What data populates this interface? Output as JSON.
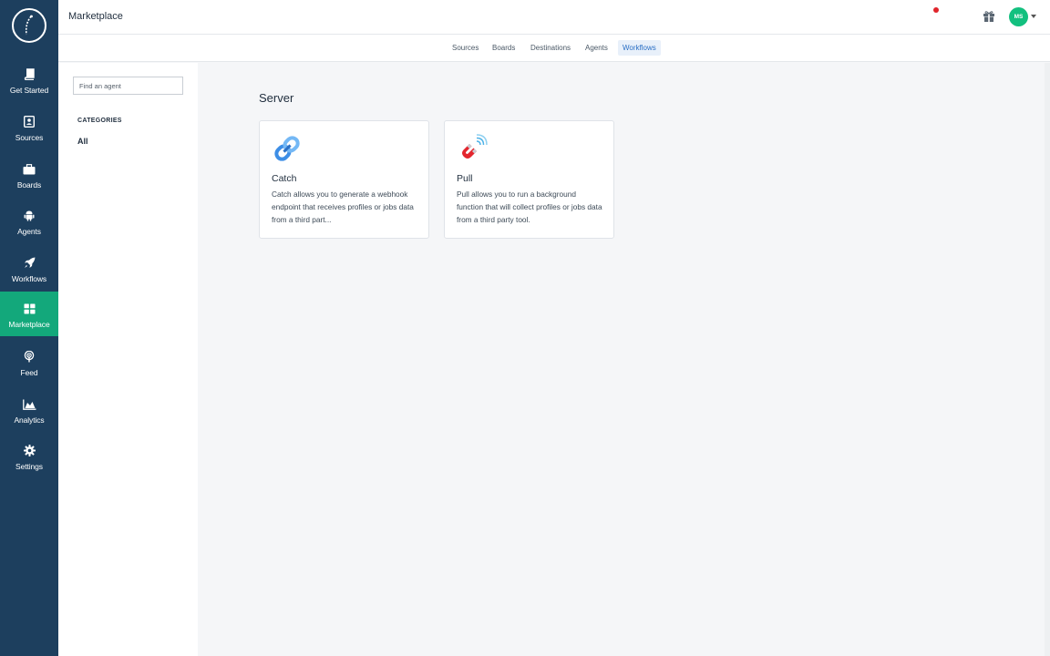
{
  "header": {
    "title": "Marketplace",
    "avatar_initials": "MS"
  },
  "nav": {
    "items": [
      {
        "label": "Get Started",
        "icon": "book-icon"
      },
      {
        "label": "Sources",
        "icon": "contact-card-icon"
      },
      {
        "label": "Boards",
        "icon": "briefcase-icon"
      },
      {
        "label": "Agents",
        "icon": "android-icon"
      },
      {
        "label": "Workflows",
        "icon": "rocket-icon"
      },
      {
        "label": "Marketplace",
        "icon": "grid-icon",
        "active": true
      },
      {
        "label": "Feed",
        "icon": "podcast-icon"
      },
      {
        "label": "Analytics",
        "icon": "area-chart-icon"
      },
      {
        "label": "Settings",
        "icon": "gear-icon"
      }
    ]
  },
  "tabs": [
    {
      "label": "Sources"
    },
    {
      "label": "Boards"
    },
    {
      "label": "Destinations"
    },
    {
      "label": "Agents"
    },
    {
      "label": "Workflows",
      "active": true
    }
  ],
  "filter": {
    "search_placeholder": "Find an agent",
    "categories_heading": "CATEGORIES",
    "category_all": "All"
  },
  "main": {
    "section_title": "Server",
    "cards": [
      {
        "name": "Catch",
        "icon": "chain-link-icon",
        "description": "Catch allows you to generate a webhook endpoint that receives profiles or jobs data from a third part..."
      },
      {
        "name": "Pull",
        "icon": "magnet-signal-icon",
        "description": "Pull allows you to run a background function that will collect profiles or jobs data from a third party tool."
      }
    ]
  },
  "colors": {
    "nav_bg": "#1d3f5e",
    "nav_active": "#13a87b",
    "avatar": "#13c07f",
    "tab_active_text": "#2a6fc5",
    "notification_dot": "#e0242b"
  }
}
